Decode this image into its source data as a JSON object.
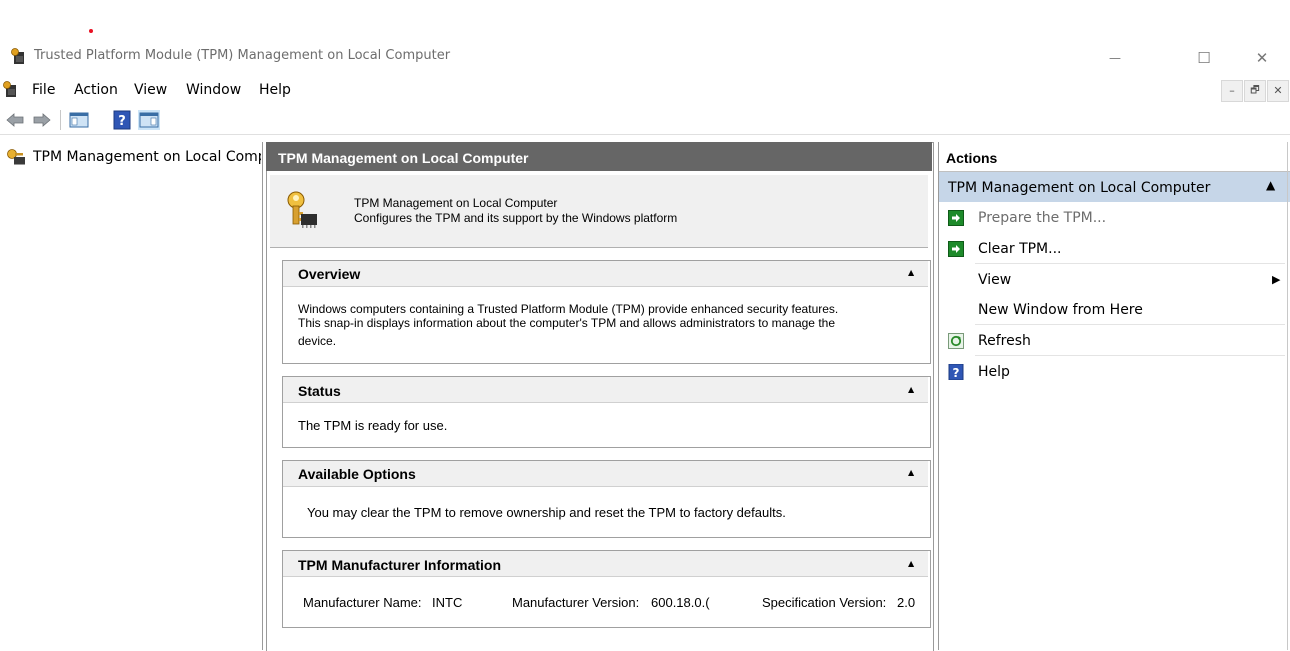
{
  "window": {
    "title": "Trusted Platform Module (TPM) Management on Local Computer",
    "minimize_glyph": "—",
    "maximize_glyph": "☐",
    "close_glyph": "✕"
  },
  "menu": {
    "items": [
      "File",
      "Action",
      "View",
      "Window",
      "Help"
    ],
    "mdi_minimize": "–",
    "mdi_restore": "🗗",
    "mdi_close": "✕"
  },
  "toolbar": {
    "icons": [
      "back-arrow-icon",
      "forward-arrow-icon",
      "show-hide-console-tree-icon",
      "help-icon",
      "show-hide-action-pane-icon"
    ]
  },
  "tree": {
    "root_label": "TPM Management on Local Compu"
  },
  "center": {
    "header_title": "TPM Management on Local Computer",
    "info_title": "TPM Management on Local Computer",
    "info_desc": "Configures the TPM and its support by the Windows platform",
    "sections": {
      "overview": {
        "title": "Overview",
        "line1": "Windows computers containing a Trusted Platform Module (TPM) provide enhanced security features.",
        "line2": "This snap-in displays information about the computer's TPM and allows administrators to manage the",
        "line3": "device."
      },
      "status": {
        "title": "Status",
        "text": "The TPM is ready for use."
      },
      "options": {
        "title": "Available Options",
        "text": "You may clear the TPM to remove ownership and reset the TPM to factory defaults."
      },
      "manufacturer": {
        "title": "TPM Manufacturer Information",
        "name_label": "Manufacturer Name:",
        "name_value": "INTC",
        "version_label": "Manufacturer Version:",
        "version_value": "600.18.0.(",
        "spec_label": "Specification Version:",
        "spec_value": "2.0"
      }
    }
  },
  "actions": {
    "title": "Actions",
    "group_label": "TPM Management on Local Computer",
    "items": [
      {
        "label": "Prepare the TPM...",
        "icon": "green-arrow-icon",
        "enabled": false
      },
      {
        "label": "Clear TPM...",
        "icon": "green-arrow-icon",
        "enabled": true
      },
      {
        "label": "View",
        "icon": "",
        "enabled": true
      },
      {
        "label": "New Window from Here",
        "icon": "",
        "enabled": true
      },
      {
        "label": "Refresh",
        "icon": "refresh-icon",
        "enabled": true
      },
      {
        "label": "Help",
        "icon": "help-icon",
        "enabled": true
      }
    ]
  },
  "colors": {
    "center_header_bg": "#666666",
    "actions_group_bg": "#c6d6e8",
    "disabled_text": "#6d6d6d"
  }
}
